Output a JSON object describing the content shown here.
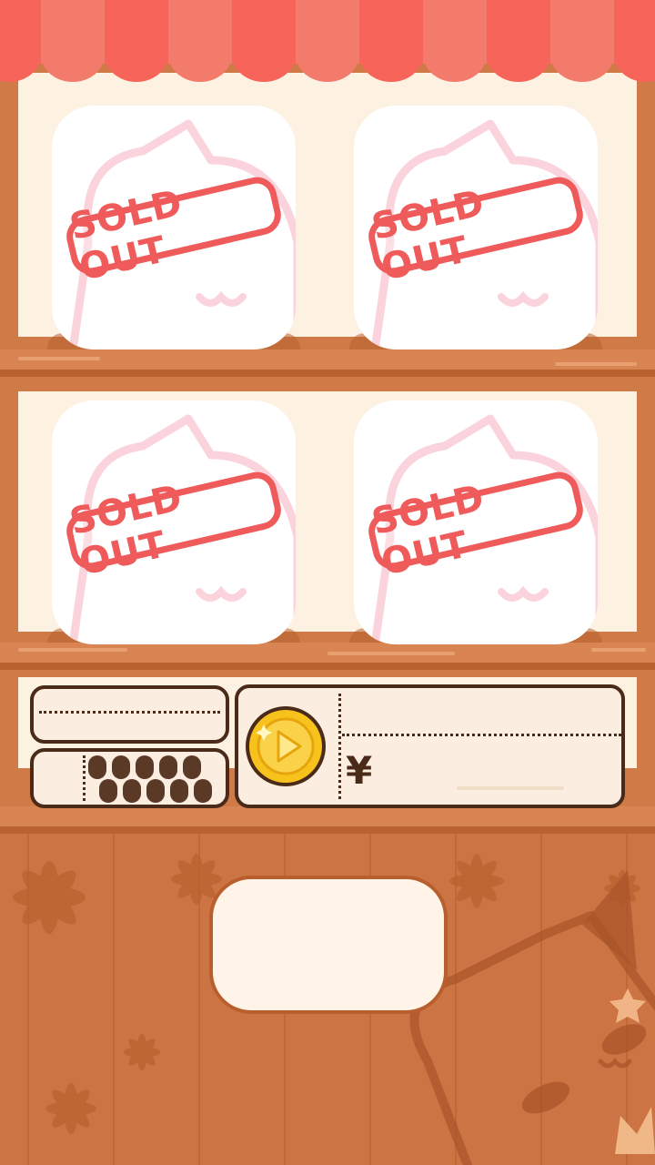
{
  "shelves": {
    "slots": [
      {
        "stamp_text": "SOLD OUT"
      },
      {
        "stamp_text": "SOLD OUT"
      },
      {
        "stamp_text": "SOLD OUT"
      },
      {
        "stamp_text": "SOLD OUT"
      }
    ]
  },
  "panel": {
    "currency_symbol": "¥",
    "product_label": "",
    "price_value": ""
  },
  "colors": {
    "awning_red": "#f7645a",
    "sold_out_red": "#ef5a5a",
    "wood": "#cf7a47",
    "panel_border": "#4a2a18",
    "coin_gold": "#f7c21c"
  },
  "icons": {
    "coin": "play-coin-icon",
    "slot_art": "cat-face-icon"
  }
}
